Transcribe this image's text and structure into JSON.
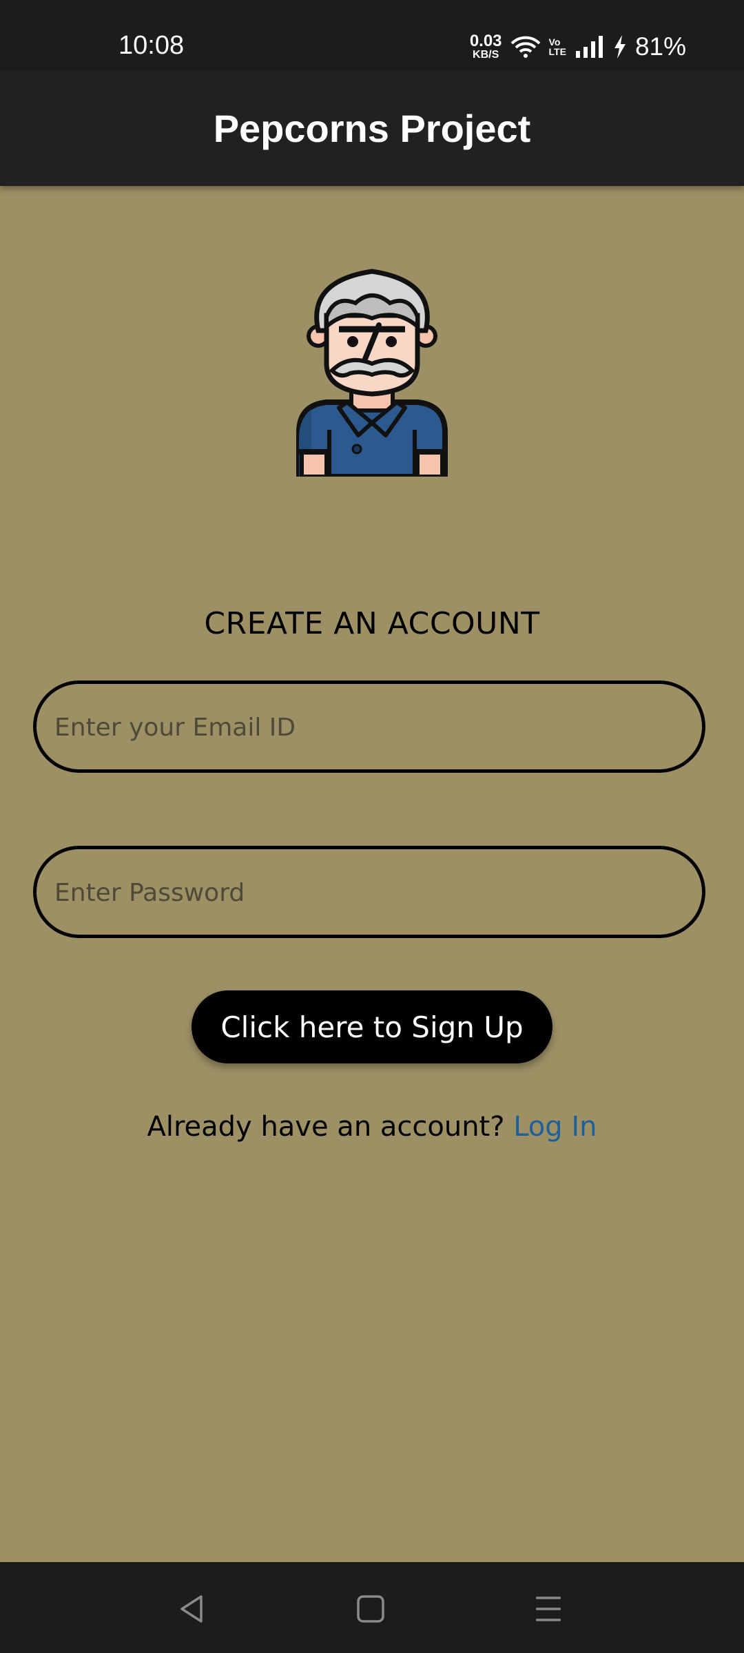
{
  "status_bar": {
    "time": "10:08",
    "net_speed_value": "0.03",
    "net_speed_unit": "KB/S",
    "volte_top": "Vo",
    "volte_bottom": "LTE",
    "battery": "81%"
  },
  "app_bar": {
    "title": "Pepcorns Project"
  },
  "form": {
    "heading": "CREATE AN ACCOUNT",
    "email_placeholder": "Enter your Email ID",
    "email_value": "",
    "password_placeholder": "Enter Password",
    "password_value": "",
    "signup_label": "Click here to Sign Up",
    "login_prompt": "Already have an account?",
    "login_link": "Log In"
  },
  "nav_bar": {
    "icons": [
      "back-icon",
      "home-icon",
      "menu-icon"
    ]
  },
  "colors": {
    "background": "#9d9065",
    "app_bar": "#212121",
    "status_bar": "#1c1c1c",
    "link": "#1f5f9a",
    "button": "#000000"
  }
}
